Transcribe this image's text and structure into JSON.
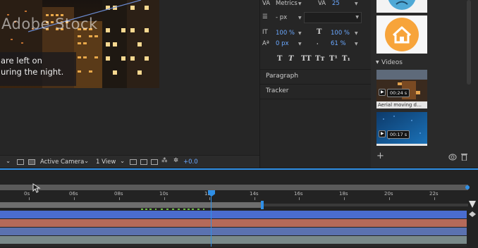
{
  "viewer": {
    "stock_text": "Adobe Stock",
    "caption_line1": "are left on",
    "caption_line2": "uring the night."
  },
  "viewer_toolbar": {
    "camera": "Active Camera",
    "view": "1 View",
    "exposure": "+0.0"
  },
  "character": {
    "kerning_label": "Metrics",
    "tracking_value": "25",
    "leading_value": "- px",
    "vscale": "100 %",
    "hscale": "100 %",
    "baseline": "0 px",
    "tsume": "61 %",
    "style_buttons": [
      "T",
      "T",
      "TT",
      "Tт",
      "T¹",
      "T₁"
    ],
    "paragraph_label": "Paragraph",
    "tracker_label": "Tracker"
  },
  "library": {
    "videos_label": "Videos",
    "video1_title": "Aerial moving d…",
    "video1_time": "00:24 s",
    "video2_time": "00:17 s",
    "icons": [
      "plus-icon",
      "cc-icon",
      "trash-icon"
    ]
  },
  "timeline": {
    "ticks": [
      "0s",
      "06s",
      "08s",
      "10s",
      "12s",
      "14s",
      "16s",
      "18s",
      "20s",
      "22s"
    ],
    "accent": "#2f8fe6",
    "track_colors": [
      "#4a6ccf",
      "#b56a5a",
      "#5b72b0",
      "#7a8a8a"
    ]
  }
}
